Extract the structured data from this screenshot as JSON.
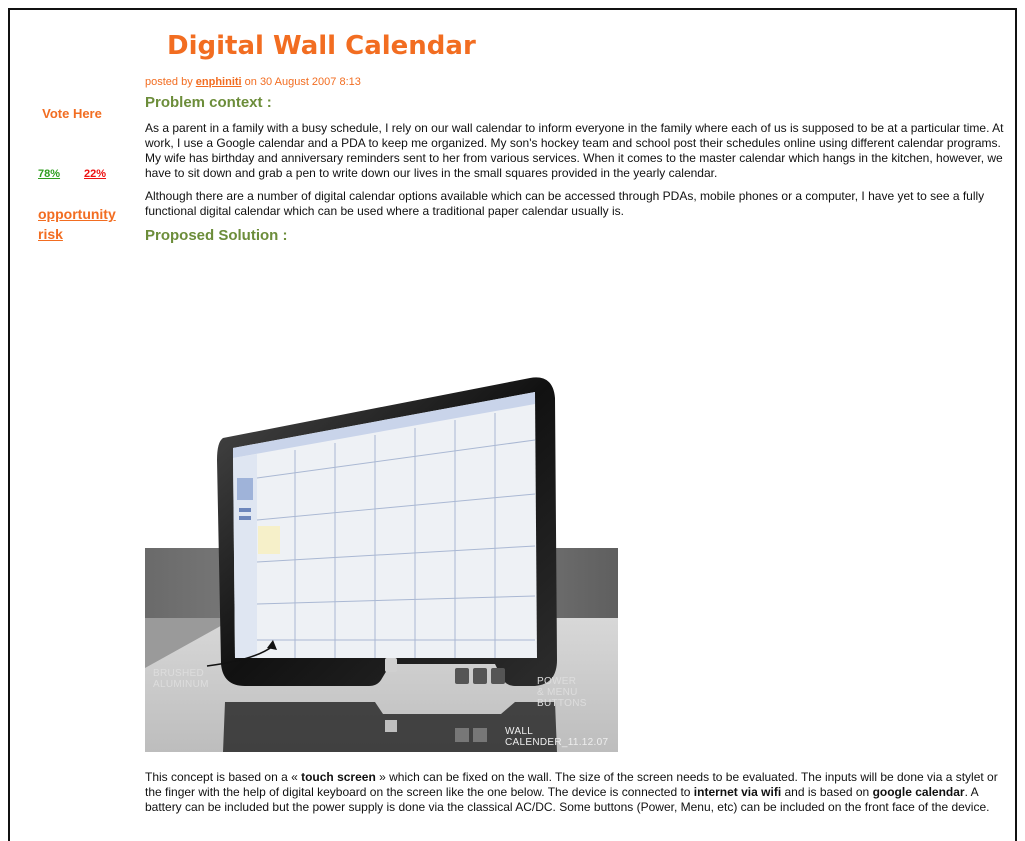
{
  "sidebar": {
    "vote_label": "Vote Here",
    "yes_percent": "78%",
    "no_percent": "22%",
    "link_opportunity": "opportunity",
    "link_risk": "risk"
  },
  "article": {
    "title": "Digital Wall Calendar",
    "byline_prefix": "posted by ",
    "author": "enphiniti",
    "byline_suffix": " on 30 August 2007 8:13",
    "section1_heading": "Problem context :",
    "para1": "As a parent in a family with a busy schedule, I rely on our wall calendar to inform everyone in the family where each of us is supposed to be at a particular time. At work, I use a Google calendar and a PDA to keep me organized. My son's hockey team and school post their schedules online using different calendar programs. My wife has birthday and anniversary reminders sent to her from various services. When it comes to the master calendar which hangs in the kitchen, however, we have to sit down and grab a pen to write down our lives in the small squares provided in the yearly calendar.",
    "para2": "Although there are a number of digital calendar options available which can be accessed through PDAs, mobile phones or a computer, I have yet to see a fully functional digital calendar which can be used where a traditional paper calendar usually is.",
    "section2_heading": "Proposed Solution :",
    "para3_a": "This concept is based on a « ",
    "para3_b": "touch screen",
    "para3_c": " » which can be fixed on the wall. The size of the screen needs to be evaluated. The inputs will be done via a stylet or the finger with the help of digital keyboard on the screen like the one below. The device is connected to ",
    "para3_d": "internet via wifi",
    "para3_e": " and is based on ",
    "para3_f": "google calendar",
    "para3_g": ". A battery can be included but the power supply is done via the classical AC/DC. Some buttons (Power, Menu, etc) can be included on the front face of the device."
  },
  "figure": {
    "label_brushed": "BRUSHED\nALUMINUM",
    "label_buttons": "POWER\n& MENU\nBUTTONS",
    "caption": "WALL CALENDER_11.12.07",
    "colors": {
      "bg": "#ffffff",
      "floor": "#d7d7d7",
      "bezel": "#1b1b1b",
      "screen": "#eef1f5",
      "accent": "#9fb3d9"
    }
  }
}
